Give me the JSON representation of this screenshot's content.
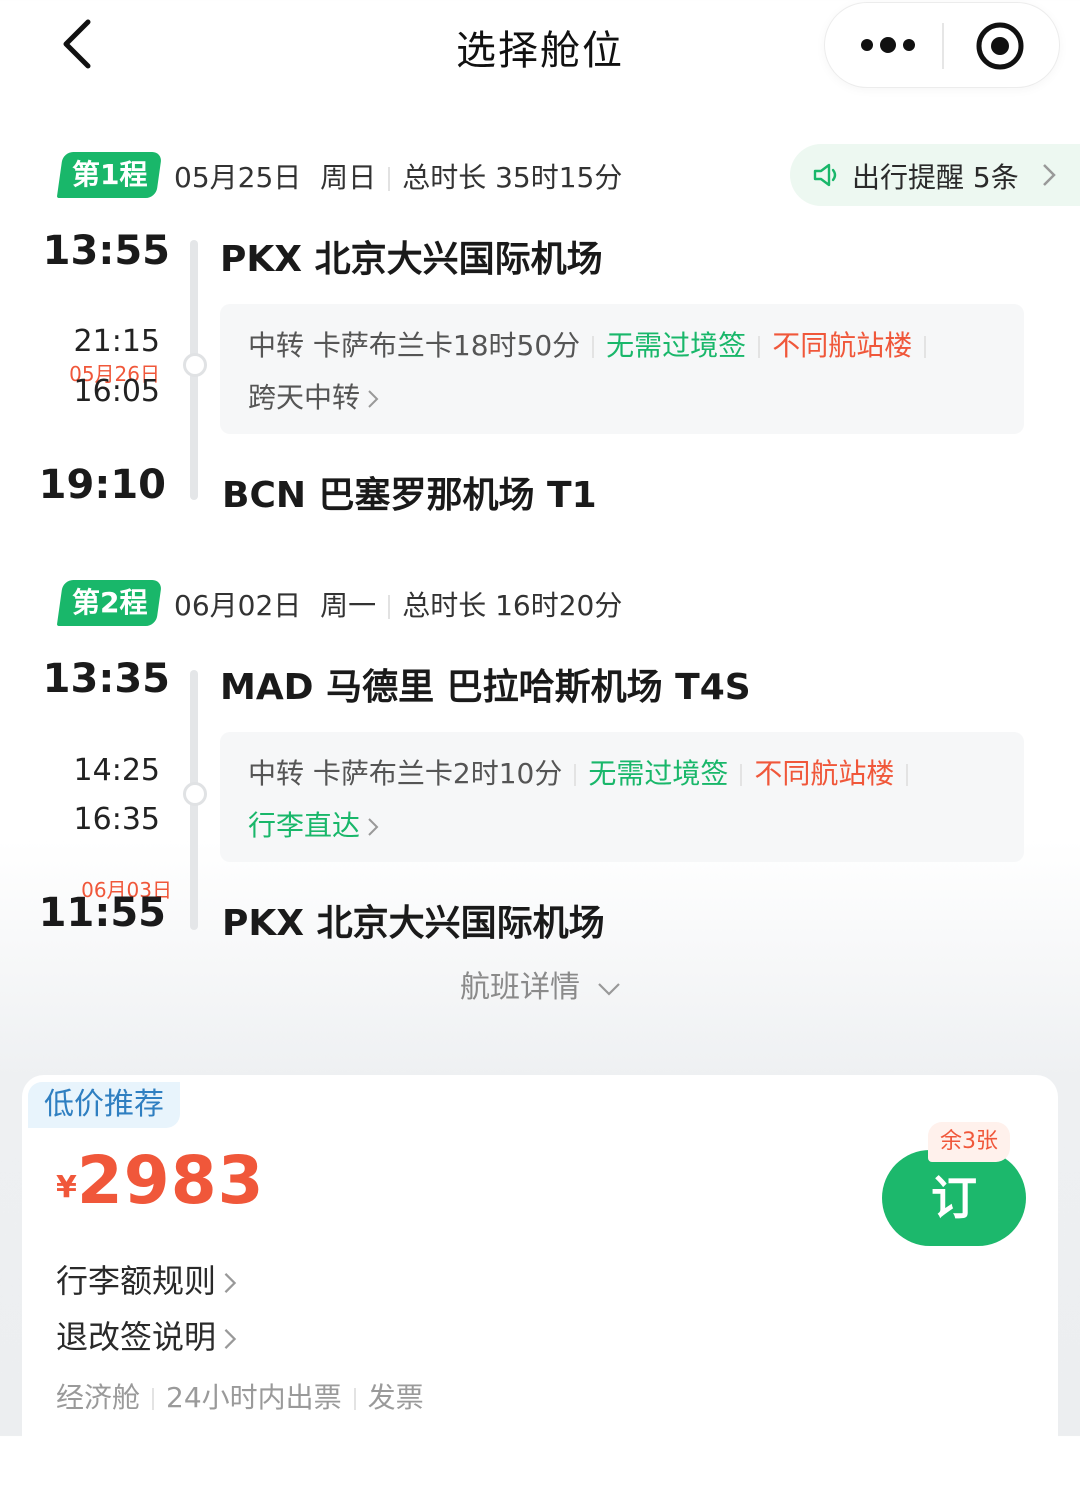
{
  "header": {
    "title": "选择舱位"
  },
  "legs": [
    {
      "badge": "第1程",
      "date": "05月25日",
      "weekday": "周日",
      "duration": "总时长 35时15分",
      "depart_time": "13:55",
      "depart_airport": "PKX 北京大兴国际机场",
      "transfer_arrive": "21:15",
      "transfer_date": "05月26日",
      "transfer_depart": "16:05",
      "transfer_text": "中转 卡萨布兰卡18时50分",
      "visa_tag": "无需过境签",
      "terminal_tag": "不同航站楼",
      "extra_link": "跨天中转",
      "arrive_time": "19:10",
      "arrive_airport": "BCN 巴塞罗那机场 T1"
    },
    {
      "badge": "第2程",
      "date": "06月02日",
      "weekday": "周一",
      "duration": "总时长 16时20分",
      "depart_time": "13:35",
      "depart_airport": "MAD 马德里 巴拉哈斯机场 T4S",
      "transfer_arrive": "14:25",
      "transfer_depart": "16:35",
      "transfer_text": "中转 卡萨布兰卡2时10分",
      "visa_tag": "无需过境签",
      "terminal_tag": "不同航站楼",
      "extra_link": "行李直达",
      "arrive_date": "06月03日",
      "arrive_time": "11:55",
      "arrive_airport": "PKX 北京大兴国际机场"
    }
  ],
  "reminder": {
    "label": "出行提醒 5条"
  },
  "details_link": "航班详情",
  "fare": {
    "tag": "低价推荐",
    "currency": "¥",
    "price": "2983",
    "remaining": "余3张",
    "book_label": "订",
    "baggage_rule": "行李额规则",
    "change_rule": "退改签说明",
    "cabin": "经济舱",
    "ticketing": "24小时内出票",
    "invoice": "发票"
  },
  "colors": {
    "brand_green": "#19b76a",
    "price_orange": "#f0573a",
    "tag_blue": "#2f7fc1"
  },
  "icons": [
    "back-arrow-icon",
    "more-dots-icon",
    "target-icon",
    "speaker-icon",
    "chevron-right-icon",
    "chevron-down-icon"
  ]
}
